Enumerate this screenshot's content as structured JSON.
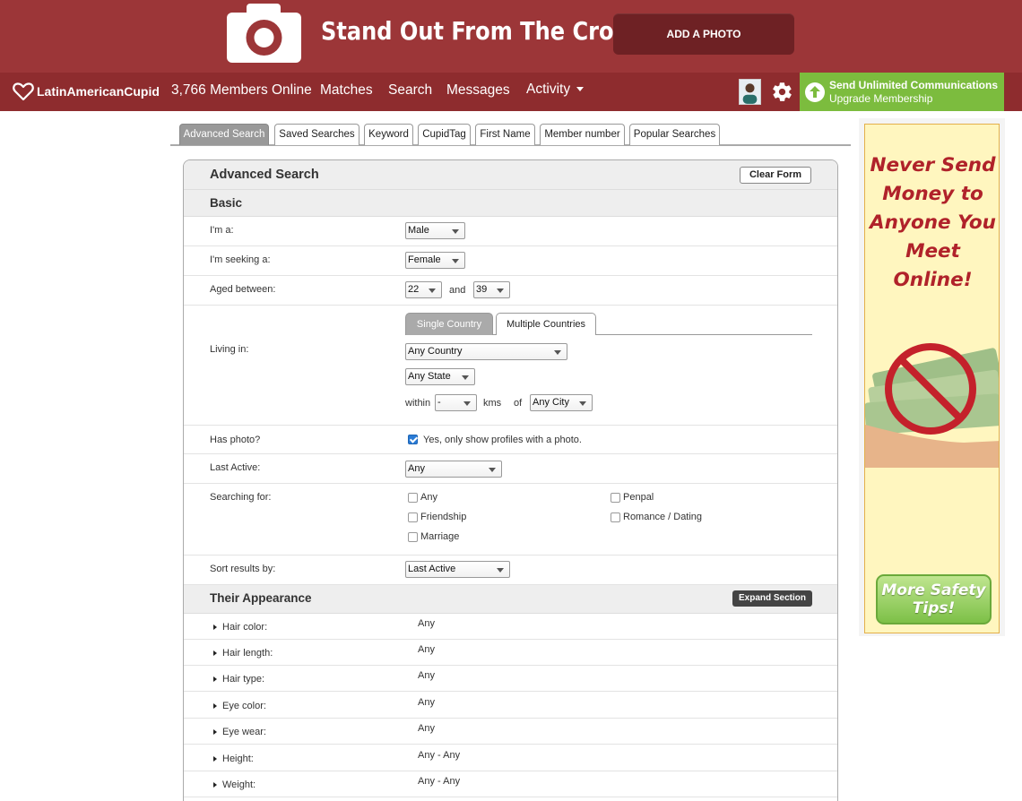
{
  "promo": {
    "headline": "Stand Out From The Crowd",
    "button": "ADD A PHOTO"
  },
  "nav": {
    "logo": "LatinAmericanCupid",
    "members_online": "3,766 Members Online",
    "matches": "Matches",
    "search": "Search",
    "messages": "Messages",
    "activity": "Activity",
    "upgrade_line1": "Send Unlimited Communications",
    "upgrade_line2": "Upgrade Membership"
  },
  "tabs": [
    "Advanced Search",
    "Saved Searches",
    "Keyword",
    "CupidTag",
    "First Name",
    "Member number",
    "Popular Searches"
  ],
  "panel": {
    "title": "Advanced Search",
    "clear_button": "Clear Form"
  },
  "basic": {
    "heading": "Basic",
    "im_a_label": "I'm a:",
    "im_a_value": "Male",
    "seeking_label": "I'm seeking a:",
    "seeking_value": "Female",
    "aged_label": "Aged between:",
    "age_min": "22",
    "age_and": "and",
    "age_max": "39",
    "living_label": "Living in:",
    "country_tabs": [
      "Single Country",
      "Multiple Countries"
    ],
    "country_value": "Any Country",
    "state_value": "Any State",
    "within_label": "within",
    "distance_value": "-",
    "kms_label": "kms",
    "of_label": "of",
    "city_value": "Any City",
    "photo_label": "Has photo?",
    "photo_option": "Yes, only show profiles with a photo.",
    "photo_checked": true,
    "last_active_label": "Last Active:",
    "last_active_value": "Any",
    "searching_label": "Searching for:",
    "searching_options": [
      "Any",
      "Friendship",
      "Marriage",
      "Penpal",
      "Romance / Dating"
    ],
    "sort_label": "Sort results by:",
    "sort_value": "Last Active"
  },
  "appearance": {
    "heading": "Their Appearance",
    "expand_button": "Expand Section",
    "rows": [
      {
        "name": "Hair color:",
        "value": "Any"
      },
      {
        "name": "Hair length:",
        "value": "Any"
      },
      {
        "name": "Hair type:",
        "value": "Any"
      },
      {
        "name": "Eye color:",
        "value": "Any"
      },
      {
        "name": "Eye wear:",
        "value": "Any"
      },
      {
        "name": "Height:",
        "value": "Any - Any"
      },
      {
        "name": "Weight:",
        "value": "Any - Any"
      }
    ]
  },
  "ad": {
    "line1": "Never Send",
    "line2": "Money to",
    "line3": "Anyone You",
    "line4": "Meet Online!",
    "button_line1": "More Safety",
    "button_line2": "Tips!"
  },
  "colors": {
    "promo_bg": "#9c3638",
    "nav_bg": "#8e2c2e",
    "upgrade_bg": "#7cbc3e",
    "ad_text": "#b0222a"
  }
}
